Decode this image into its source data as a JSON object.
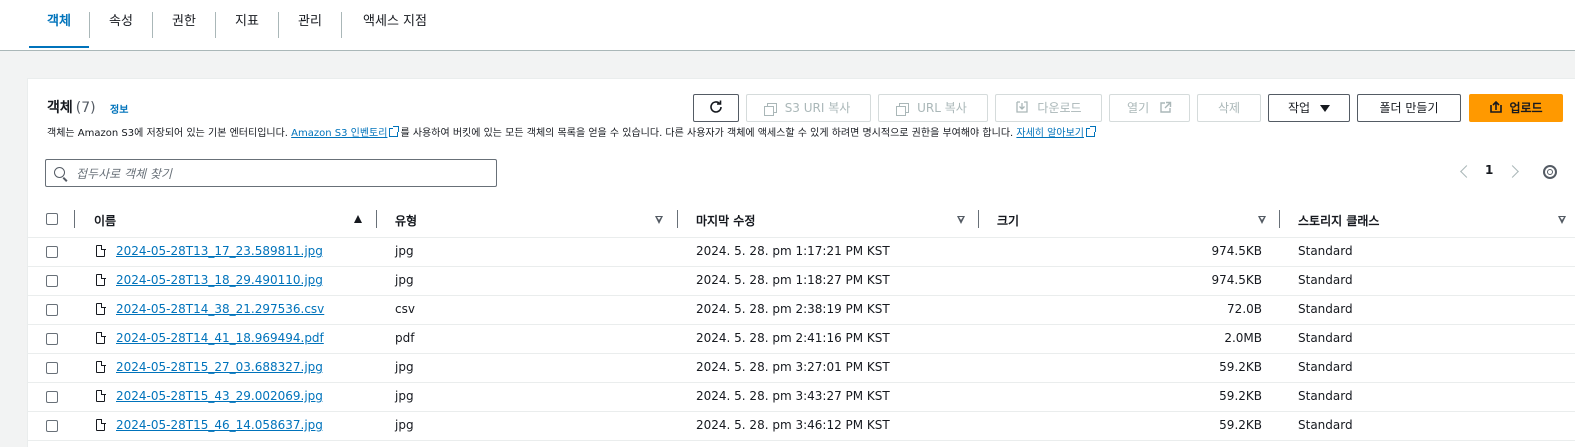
{
  "tabs": [
    "객체",
    "속성",
    "권한",
    "지표",
    "관리",
    "액세스 지점"
  ],
  "active_tab": "객체",
  "section": {
    "title": "객체",
    "count": "(7)",
    "info": "정보",
    "desc_before": "객체는 Amazon S3에 저장되어 있는 기본 엔터티입니다.",
    "desc_link1": "Amazon S3 인벤토리",
    "desc_middle": "를 사용하여 버킷에 있는 모든 객체의 목록을 얻을 수 있습니다. 다른 사용자가 객체에 액세스할 수 있게 하려면 명시적으로 권한을 부여해야 합니다.",
    "desc_link2": "자세히 알아보기"
  },
  "toolbar": {
    "refresh": "",
    "copy_s3_uri": "S3 URI 복사",
    "copy_url": "URL 복사",
    "download": "다운로드",
    "open": "열기",
    "delete": "삭제",
    "actions": "작업",
    "create_folder": "폴더 만들기",
    "upload": "업로드"
  },
  "search": {
    "placeholder": "접두사로 객체 찾기",
    "value": ""
  },
  "pagination": {
    "page": "1"
  },
  "columns": {
    "name": "이름",
    "type": "유형",
    "modified": "마지막 수정",
    "size": "크기",
    "storage": "스토리지 클래스"
  },
  "rows": [
    {
      "name": "2024-05-28T13_17_23.589811.jpg",
      "type": "jpg",
      "modified": "2024. 5. 28. pm 1:17:21 PM KST",
      "size": "974.5KB",
      "storage": "Standard"
    },
    {
      "name": "2024-05-28T13_18_29.490110.jpg",
      "type": "jpg",
      "modified": "2024. 5. 28. pm 1:18:27 PM KST",
      "size": "974.5KB",
      "storage": "Standard"
    },
    {
      "name": "2024-05-28T14_38_21.297536.csv",
      "type": "csv",
      "modified": "2024. 5. 28. pm 2:38:19 PM KST",
      "size": "72.0B",
      "storage": "Standard"
    },
    {
      "name": "2024-05-28T14_41_18.969494.pdf",
      "type": "pdf",
      "modified": "2024. 5. 28. pm 2:41:16 PM KST",
      "size": "2.0MB",
      "storage": "Standard"
    },
    {
      "name": "2024-05-28T15_27_03.688327.jpg",
      "type": "jpg",
      "modified": "2024. 5. 28. pm 3:27:01 PM KST",
      "size": "59.2KB",
      "storage": "Standard"
    },
    {
      "name": "2024-05-28T15_43_29.002069.jpg",
      "type": "jpg",
      "modified": "2024. 5. 28. pm 3:43:27 PM KST",
      "size": "59.2KB",
      "storage": "Standard"
    },
    {
      "name": "2024-05-28T15_46_14.058637.jpg",
      "type": "jpg",
      "modified": "2024. 5. 28. pm 3:46:12 PM KST",
      "size": "59.2KB",
      "storage": "Standard"
    }
  ]
}
